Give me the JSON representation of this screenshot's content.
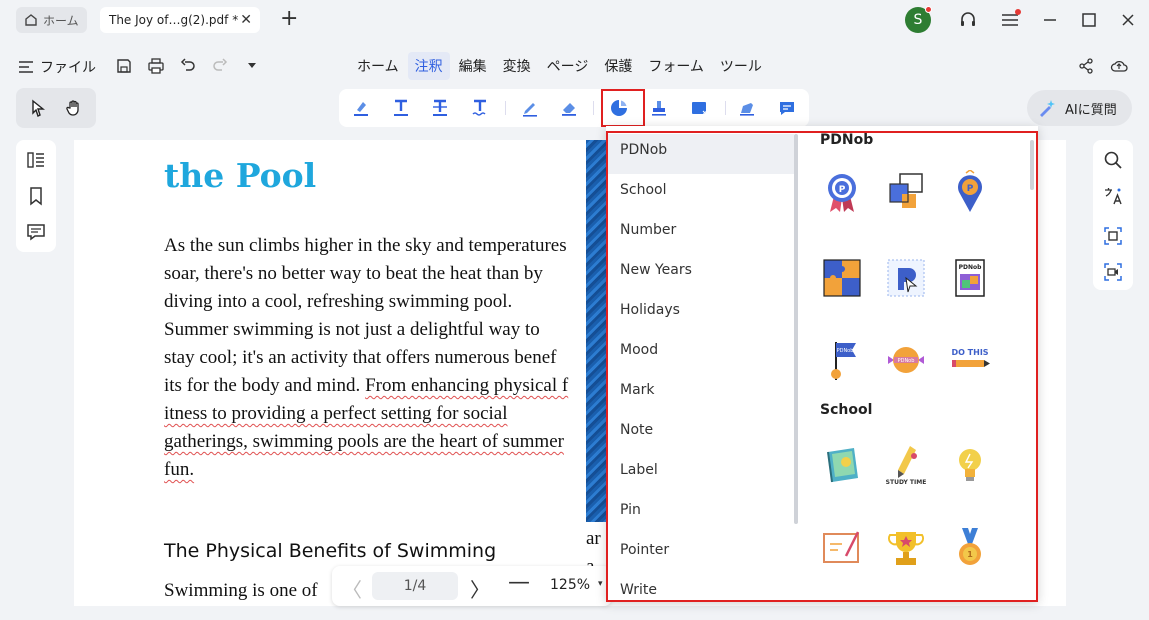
{
  "tabs": {
    "home_label": "ホーム",
    "doc_label": "The Joy of…g(2).pdf *",
    "close_glyph": "✕",
    "new_tab_glyph": "+"
  },
  "user": {
    "avatar_initial": "S"
  },
  "menubar": {
    "file_label": "ファイル",
    "items": [
      "ホーム",
      "注釈",
      "編集",
      "変換",
      "ページ",
      "保護",
      "フォーム",
      "ツール"
    ],
    "active_index": 1
  },
  "toolbar": {
    "ai_label": "AIに質問"
  },
  "document": {
    "title": "the Pool",
    "para_plain": "As the sun climbs higher in the sky and temperatures soar, there's no better way to beat the heat than by diving into a cool, refreshing swimming pool. Summer swimming is not just a delightful way to stay cool; it's an activity that offers numerous benef  its for the body and mind. ",
    "para_squiggle": "From enhancing physical f  itness to providing a perfect setting for social gatherings, swimming pools are the heart of summer fun.",
    "heading": "The Physical Benefits of Swimming",
    "line": "Swimming is one of",
    "side_text_1": "ar",
    "side_text_2": "a"
  },
  "pagenav": {
    "prev_glyph": "〈",
    "page_indicator": "1/4",
    "next_glyph": "〉",
    "zoom_out_glyph": "—",
    "zoom_level": "125%",
    "zoom_caret": "▾"
  },
  "stickers": {
    "categories": [
      "PDNob",
      "School",
      "Number",
      "New Years",
      "Holidays",
      "Mood",
      "Mark",
      "Note",
      "Label",
      "Pin",
      "Pointer",
      "Write"
    ],
    "selected_category": "PDNob",
    "groups": [
      {
        "title": "PDNob",
        "items": [
          "award-ribbon-sticker",
          "crop-frame-sticker",
          "location-pin-sticker",
          "puzzle-sticker",
          "pdnob-logo-sticker",
          "pdnob-book-sticker",
          "flag-sticker",
          "sun-badge-sticker",
          "do-this-sticker"
        ]
      },
      {
        "title": "School",
        "items": [
          "notebook-sticker",
          "study-time-pencil-sticker",
          "lightbulb-sticker",
          "whiteboard-sticker",
          "trophy-sticker",
          "medal-sticker"
        ]
      }
    ]
  },
  "colors": {
    "accent": "#2f5fe0",
    "title_blue": "#1fa7dd",
    "highlight_red": "#e02020"
  }
}
